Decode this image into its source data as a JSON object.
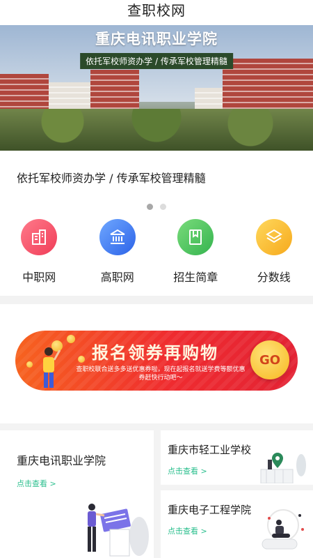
{
  "app": {
    "title": "查职校网"
  },
  "banner": {
    "school_name": "重庆电讯职业学院",
    "tagline": "依托军校师资办学 / 传承军校管理精髓",
    "caption": "依托军校师资办学 / 传承军校管理精髓",
    "slide_count": 2,
    "active_slide": 1
  },
  "nav": [
    {
      "label": "中职网",
      "icon": "building-icon",
      "color": "#f03d58"
    },
    {
      "label": "高职网",
      "icon": "institution-icon",
      "color": "#2c63e8"
    },
    {
      "label": "招生简章",
      "icon": "book-icon",
      "color": "#35b44f"
    },
    {
      "label": "分数线",
      "icon": "layers-icon",
      "color": "#f6a91c"
    }
  ],
  "promo": {
    "title": "报名领券再购物",
    "text": "查职校联合送多多送优惠券啦，现在起报名就送学费等额优惠券赶快行动吧～",
    "go_label": "GO"
  },
  "cards": [
    {
      "title": "重庆电讯职业学院",
      "link": "点击查看 >"
    },
    {
      "title": "重庆市轻工业学校",
      "link": "点击查看 >"
    },
    {
      "title": "重庆电子工程学院",
      "link": "点击查看 >"
    }
  ],
  "colors": {
    "accent_green": "#2bbf8e",
    "promo_red": "#ef2b2f",
    "promo_orange": "#f7631f"
  }
}
